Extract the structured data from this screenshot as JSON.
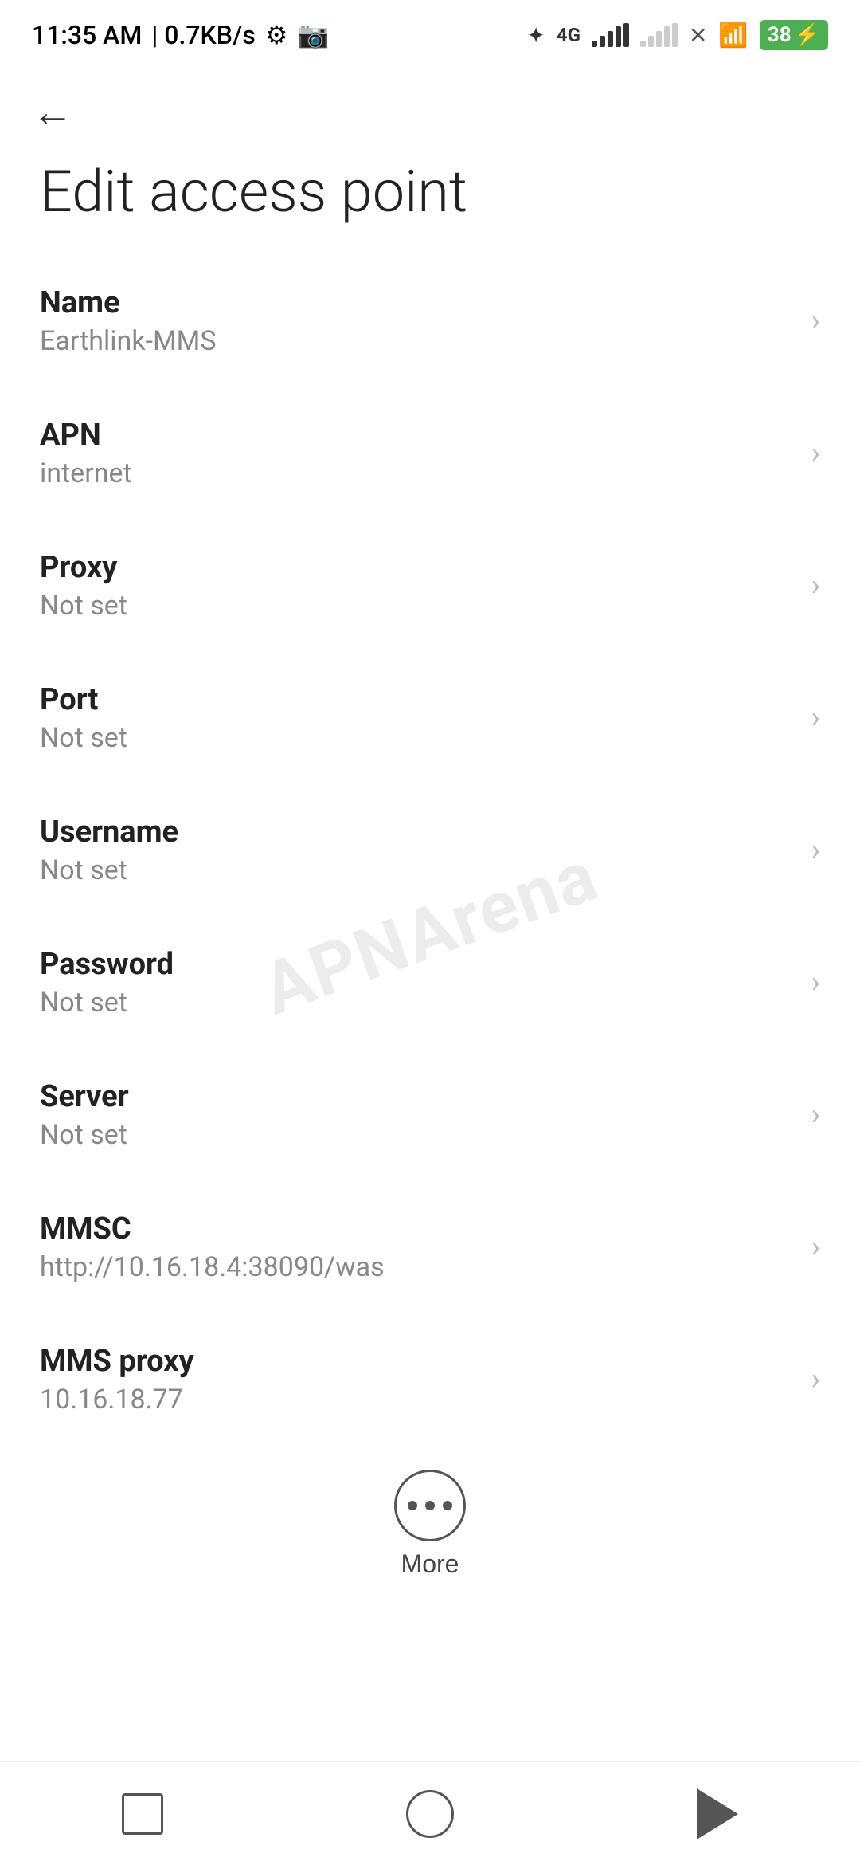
{
  "statusBar": {
    "time": "11:35 AM",
    "speed": "0.7KB/s",
    "battery": "38",
    "batterySymbol": "⚡"
  },
  "page": {
    "title": "Edit access point",
    "backLabel": "←"
  },
  "settings": [
    {
      "label": "Name",
      "value": "Earthlink-MMS"
    },
    {
      "label": "APN",
      "value": "internet"
    },
    {
      "label": "Proxy",
      "value": "Not set"
    },
    {
      "label": "Port",
      "value": "Not set"
    },
    {
      "label": "Username",
      "value": "Not set"
    },
    {
      "label": "Password",
      "value": "Not set"
    },
    {
      "label": "Server",
      "value": "Not set"
    },
    {
      "label": "MMSC",
      "value": "http://10.16.18.4:38090/was"
    },
    {
      "label": "MMS proxy",
      "value": "10.16.18.77"
    }
  ],
  "more": {
    "label": "More"
  },
  "watermark": "APNArena"
}
